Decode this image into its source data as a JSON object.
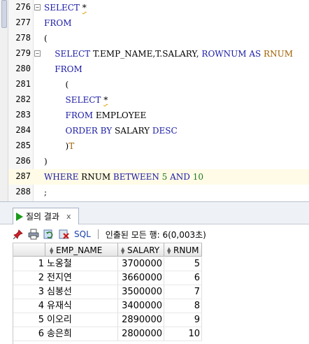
{
  "editor": {
    "lines": [
      {
        "n": "276",
        "fold": "⊟",
        "tokens": [
          {
            "t": "SELECT ",
            "c": "kw"
          },
          {
            "t": "*",
            "c": "sq"
          }
        ]
      },
      {
        "n": "277",
        "tokens": [
          {
            "t": "FROM",
            "c": "kw"
          }
        ]
      },
      {
        "n": "278",
        "tokens": [
          {
            "t": "(",
            "c": ""
          }
        ]
      },
      {
        "n": "279",
        "fold": "⊟",
        "tokens": [
          {
            "t": "    SELECT ",
            "c": "kw"
          },
          {
            "t": "T.EMP_NAME,T.SALARY, ",
            "c": ""
          },
          {
            "t": "ROWNUM AS ",
            "c": "kw"
          },
          {
            "t": "RNUM",
            "c": "str"
          }
        ]
      },
      {
        "n": "280",
        "tokens": [
          {
            "t": "    FROM",
            "c": "kw"
          }
        ]
      },
      {
        "n": "281",
        "tokens": [
          {
            "t": "        (",
            "c": ""
          }
        ]
      },
      {
        "n": "282",
        "tokens": [
          {
            "t": "        SELECT ",
            "c": "kw"
          },
          {
            "t": "*",
            "c": "sq"
          }
        ]
      },
      {
        "n": "283",
        "tokens": [
          {
            "t": "        FROM ",
            "c": "kw"
          },
          {
            "t": "EMPLOYEE",
            "c": ""
          }
        ]
      },
      {
        "n": "284",
        "tokens": [
          {
            "t": "        ORDER BY ",
            "c": "kw"
          },
          {
            "t": "SALARY ",
            "c": ""
          },
          {
            "t": "DESC",
            "c": "kw"
          }
        ]
      },
      {
        "n": "285",
        "tokens": [
          {
            "t": "        )",
            "c": ""
          },
          {
            "t": "T",
            "c": "str"
          }
        ]
      },
      {
        "n": "286",
        "tokens": [
          {
            "t": ")",
            "c": ""
          }
        ]
      },
      {
        "n": "287",
        "hl": true,
        "tokens": [
          {
            "t": "WHERE ",
            "c": "kw"
          },
          {
            "t": "RNUM ",
            "c": ""
          },
          {
            "t": "BETWEEN ",
            "c": "kw"
          },
          {
            "t": "5 ",
            "c": "num"
          },
          {
            "t": "AND ",
            "c": "kw"
          },
          {
            "t": "10",
            "c": "num"
          }
        ]
      },
      {
        "n": "288",
        "tokens": [
          {
            "t": ";",
            "c": ""
          }
        ]
      }
    ]
  },
  "results": {
    "tab_label": "질의 결과",
    "tab_close": "x",
    "toolbar": {
      "sql_label": "SQL",
      "status": "인출된 모든 행: 6(0,003초)"
    },
    "columns": [
      "EMP_NAME",
      "SALARY",
      "RNUM"
    ],
    "rows": [
      {
        "idx": "1",
        "name": "노옹철",
        "salary": "3700000",
        "rnum": "5"
      },
      {
        "idx": "2",
        "name": "전지연",
        "salary": "3660000",
        "rnum": "6"
      },
      {
        "idx": "3",
        "name": "심봉선",
        "salary": "3500000",
        "rnum": "7"
      },
      {
        "idx": "4",
        "name": "유재식",
        "salary": "3400000",
        "rnum": "8"
      },
      {
        "idx": "5",
        "name": "이오리",
        "salary": "2890000",
        "rnum": "9"
      },
      {
        "idx": "6",
        "name": "송은희",
        "salary": "2800000",
        "rnum": "10"
      }
    ]
  }
}
